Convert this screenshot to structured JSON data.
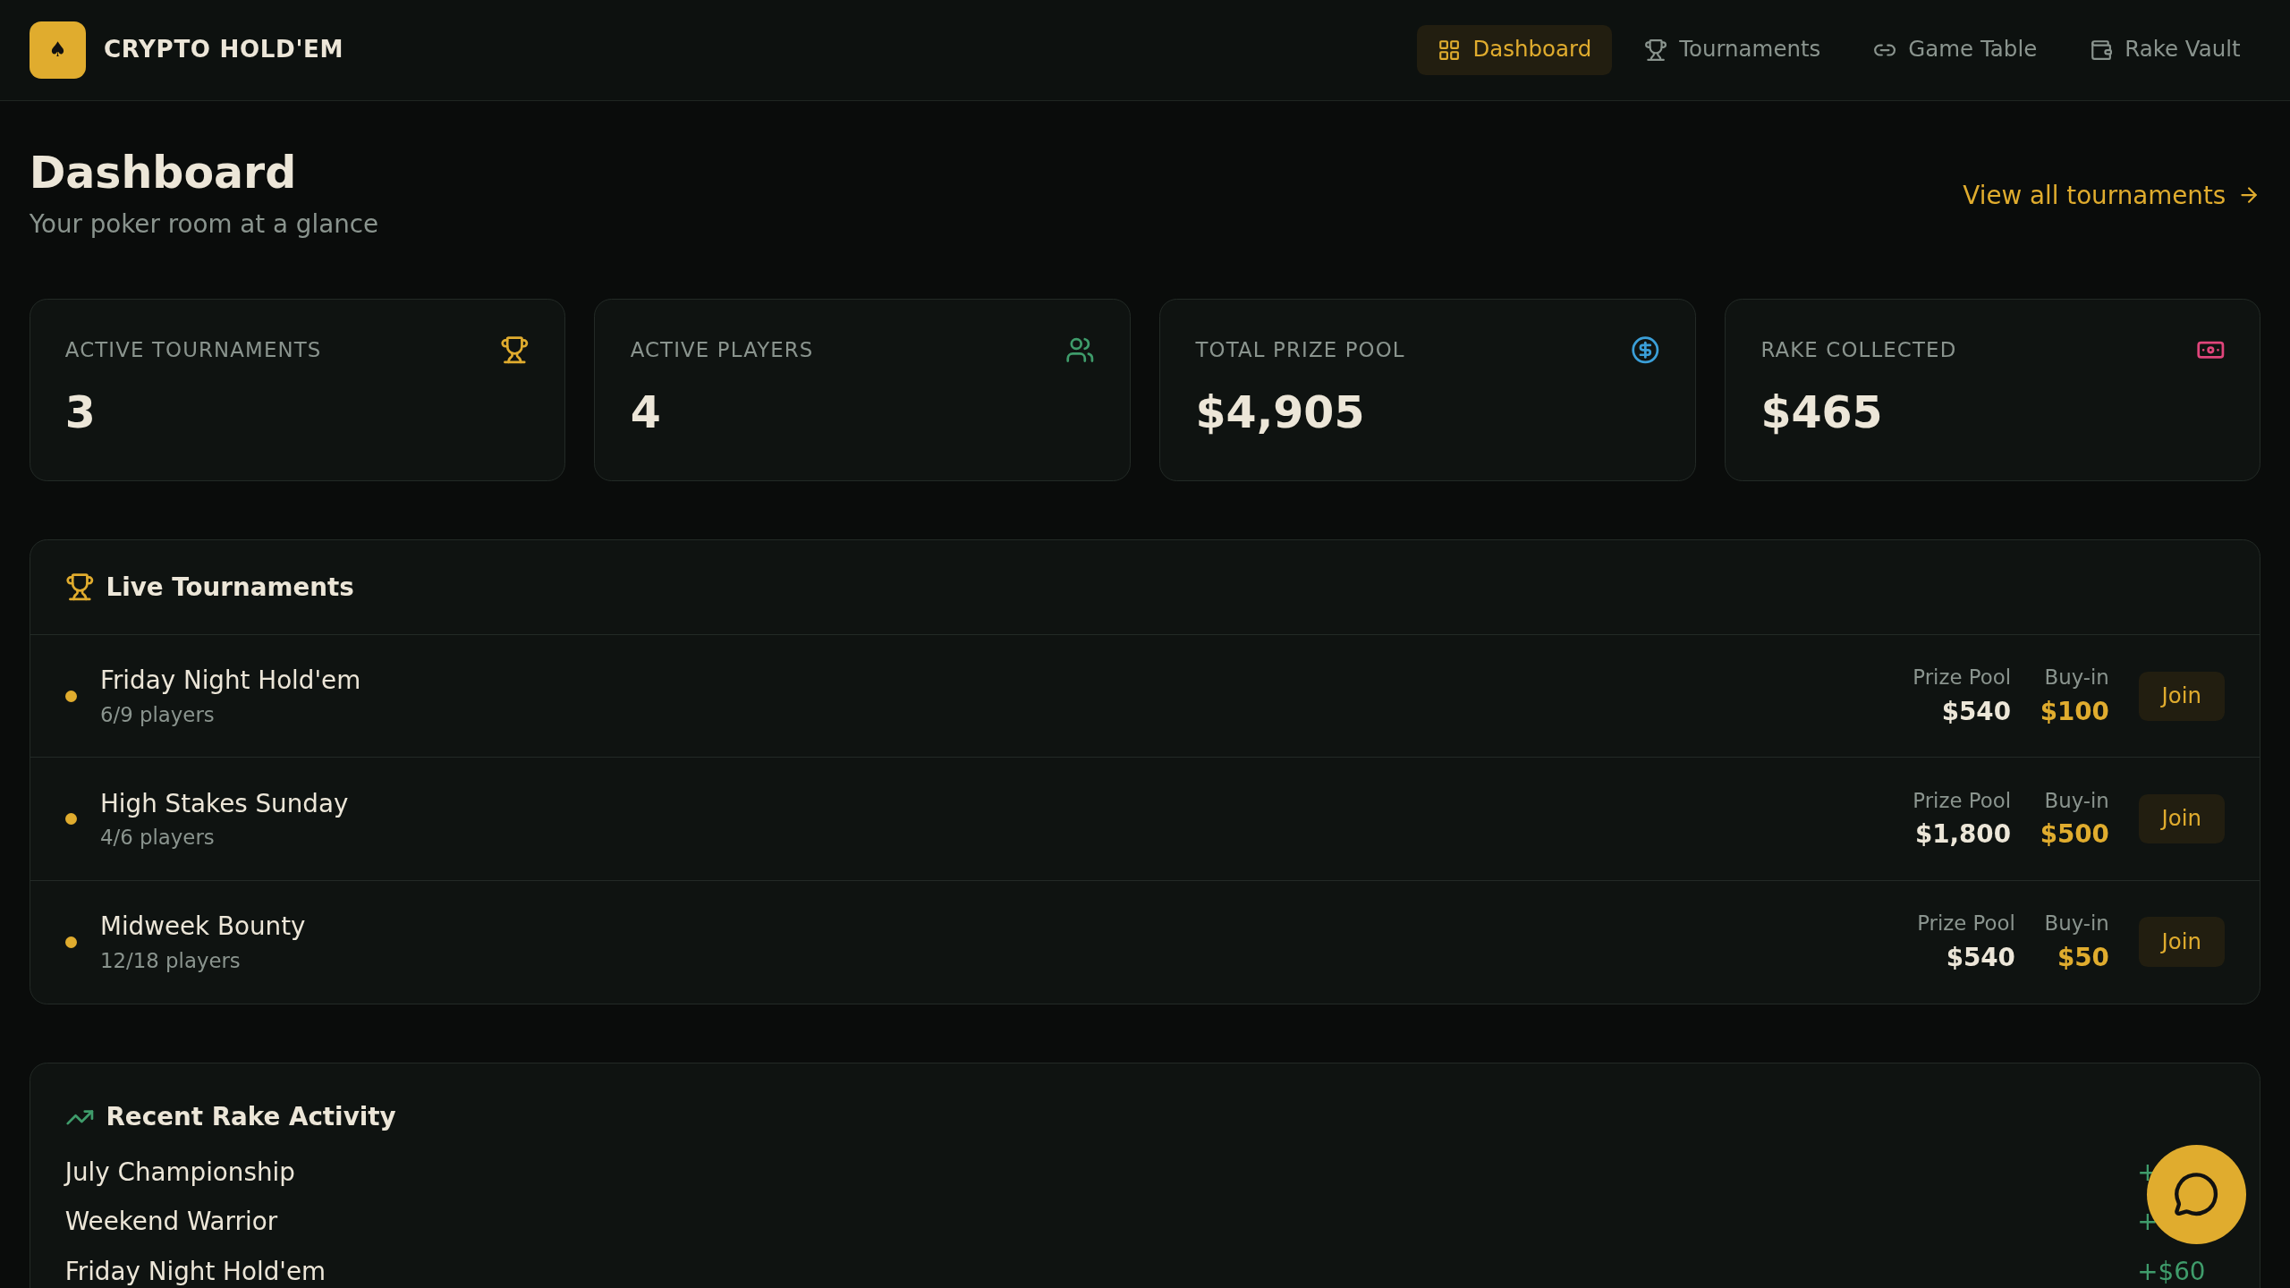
{
  "brand": {
    "logo": "♠",
    "name": "CRYPTO HOLD'EM"
  },
  "nav": [
    {
      "label": "Dashboard",
      "selected": true
    },
    {
      "label": "Tournaments",
      "selected": false
    },
    {
      "label": "Game Table",
      "selected": false
    },
    {
      "label": "Rake Vault",
      "selected": false
    }
  ],
  "page": {
    "title": "Dashboard",
    "subtitle": "Your poker room at a glance",
    "link": "View all tournaments"
  },
  "stats": [
    {
      "label": "ACTIVE TOURNAMENTS",
      "value": "3"
    },
    {
      "label": "ACTIVE PLAYERS",
      "value": "4"
    },
    {
      "label": "TOTAL PRIZE POOL",
      "value": "$4,905"
    },
    {
      "label": "RAKE COLLECTED",
      "value": "$465"
    }
  ],
  "live_tournaments": {
    "title": "Live Tournaments",
    "rows": [
      {
        "name": "Friday Night Hold'em",
        "players": "6/9 players",
        "prize_label": "Prize Pool",
        "prize": "$540",
        "buyin_label": "Buy-in",
        "buyin": "$100",
        "action": "Join"
      },
      {
        "name": "High Stakes Sunday",
        "players": "4/6 players",
        "prize_label": "Prize Pool",
        "prize": "$1,800",
        "buyin_label": "Buy-in",
        "buyin": "$500",
        "action": "Join"
      },
      {
        "name": "Midweek Bounty",
        "players": "12/18 players",
        "prize_label": "Prize Pool",
        "prize": "$540",
        "buyin_label": "Buy-in",
        "buyin": "$50",
        "action": "Join"
      }
    ]
  },
  "recent_rake": {
    "title": "Recent Rake Activity",
    "rows": [
      {
        "name": "July Championship",
        "amount": "+"
      },
      {
        "name": "Weekend Warrior",
        "amount": "+"
      },
      {
        "name": "Friday Night Hold'em",
        "amount": "+$60"
      }
    ]
  }
}
